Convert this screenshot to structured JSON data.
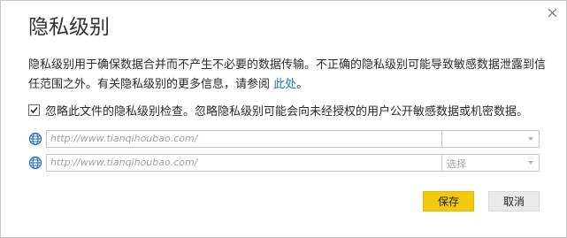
{
  "dialog": {
    "title": "隐私级别",
    "close_icon": "close-icon"
  },
  "description": {
    "text": "隐私级别用于确保数据合并而不产生不必要的数据传输。不正确的隐私级别可能导致敏感数据泄露到信任范围之外。有关隐私级别的更多信息，请参阅 ",
    "link_text": "此处",
    "suffix": "。",
    "link_color": "#1a72c4"
  },
  "ignore_checkbox": {
    "checked": true,
    "label": "忽略此文件的隐私级别检查。忽略隐私级别可能会向未经授权的用户公开敏感数据或机密数据。"
  },
  "sources": [
    {
      "icon": "globe-icon",
      "url": "http://www.tianqihoubao.com/",
      "level": ""
    },
    {
      "icon": "globe-icon",
      "url": "http://www.tianqihoubao.com/",
      "level": "选择"
    }
  ],
  "buttons": {
    "save_label": "保存",
    "cancel_label": "取消",
    "save_color": "#f2c811"
  }
}
